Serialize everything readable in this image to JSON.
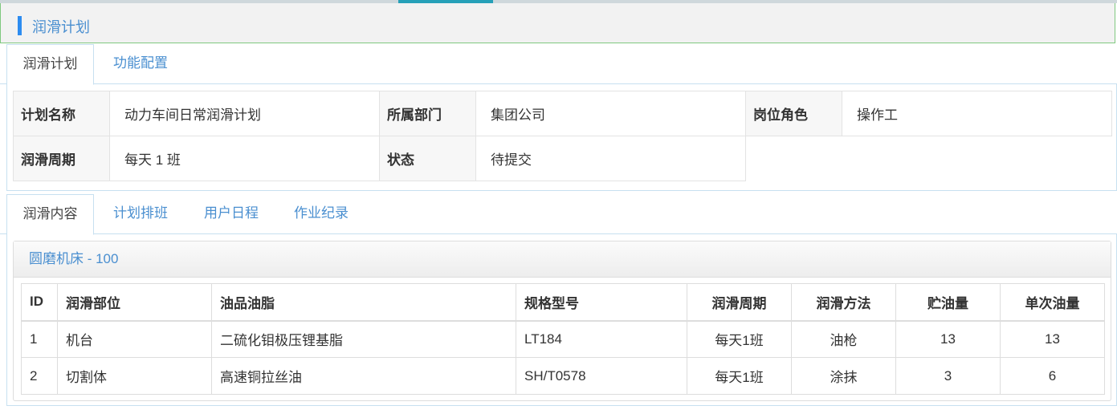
{
  "panel": {
    "title": "润滑计划"
  },
  "top_tabs": [
    {
      "label": "润滑计划",
      "active": true
    },
    {
      "label": "功能配置",
      "active": false
    }
  ],
  "plan": {
    "name_label": "计划名称",
    "name_value": "动力车间日常润滑计划",
    "dept_label": "所属部门",
    "dept_value": "集团公司",
    "role_label": "岗位角色",
    "role_value": "操作工",
    "cycle_label": "润滑周期",
    "cycle_value": "每天 1 班",
    "status_label": "状态",
    "status_value": "待提交"
  },
  "sub_tabs": [
    {
      "label": "润滑内容",
      "active": true
    },
    {
      "label": "计划排班",
      "active": false
    },
    {
      "label": "用户日程",
      "active": false
    },
    {
      "label": "作业纪录",
      "active": false
    }
  ],
  "equipment": {
    "title": "圆磨机床 - 100",
    "columns": [
      "ID",
      "润滑部位",
      "油品油脂",
      "规格型号",
      "润滑周期",
      "润滑方法",
      "贮油量",
      "单次油量"
    ],
    "rows": [
      [
        "1",
        "机台",
        "二硫化钼极压锂基脂",
        "LT184",
        "每天1班",
        "油枪",
        "13",
        "13"
      ],
      [
        "2",
        "切割体",
        "高速铜拉丝油",
        "SH/T0578",
        "每天1班",
        "涂抹",
        "3",
        "6"
      ]
    ]
  },
  "colors": {
    "accent": "#2d8cf0",
    "link": "#4a8fd0",
    "header_border": "#7fc87f",
    "top_strip_active": "#26a0b8"
  }
}
